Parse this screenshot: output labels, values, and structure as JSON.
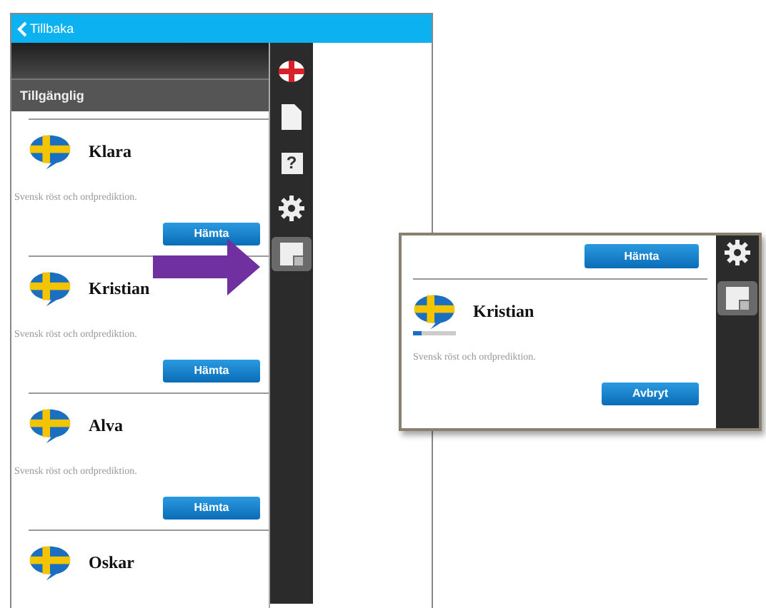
{
  "header": {
    "back_label": "Tillbaka"
  },
  "list": {
    "section_title": "Tillgänglig",
    "voices": [
      {
        "name": "Klara",
        "description": "Svensk röst och ordprediktion.",
        "button": "Hämta"
      },
      {
        "name": "Kristian",
        "description": "Svensk röst och ordprediktion.",
        "button": "Hämta"
      },
      {
        "name": "Alva",
        "description": "Svensk röst och ordprediktion.",
        "button": "Hämta"
      },
      {
        "name": "Oskar"
      }
    ]
  },
  "sidebar": {
    "items": [
      {
        "kind": "flag",
        "selected": false
      },
      {
        "kind": "document",
        "selected": false
      },
      {
        "kind": "help",
        "glyph": "?",
        "selected": false
      },
      {
        "kind": "settings",
        "selected": false
      },
      {
        "kind": "window",
        "selected": true
      }
    ]
  },
  "callout": {
    "top_button": "Hämta",
    "voice": {
      "name": "Kristian",
      "level": 0.2,
      "description": "Svensk röst och ordprediktion.",
      "button": "Avbryt"
    },
    "sidebar": [
      {
        "kind": "settings",
        "selected": false
      },
      {
        "kind": "window",
        "selected": true
      }
    ]
  }
}
